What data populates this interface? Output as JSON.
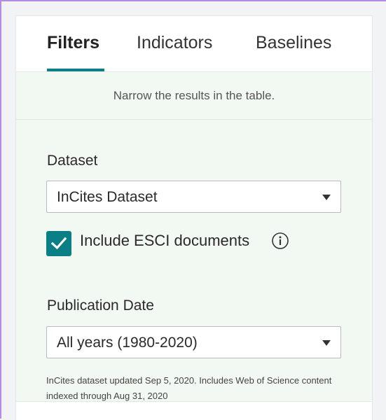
{
  "tabs": [
    {
      "label": "Filters",
      "active": true
    },
    {
      "label": "Indicators",
      "active": false
    },
    {
      "label": "Baselines",
      "active": false
    }
  ],
  "subtitle": "Narrow the results in the table.",
  "dataset": {
    "label": "Dataset",
    "selected": "InCites Dataset"
  },
  "esci": {
    "label": "Include ESCI documents",
    "checked": true,
    "icon": "info-icon"
  },
  "publication_date": {
    "label": "Publication Date",
    "selected": "All years (1980-2020)"
  },
  "note": "InCites dataset updated Sep 5, 2020. Includes Web of Science content indexed through Aug 31, 2020",
  "colors": {
    "accent": "#0a7f86",
    "panel_bg": "#f2f8f2",
    "frame_border": "#b38de0"
  }
}
